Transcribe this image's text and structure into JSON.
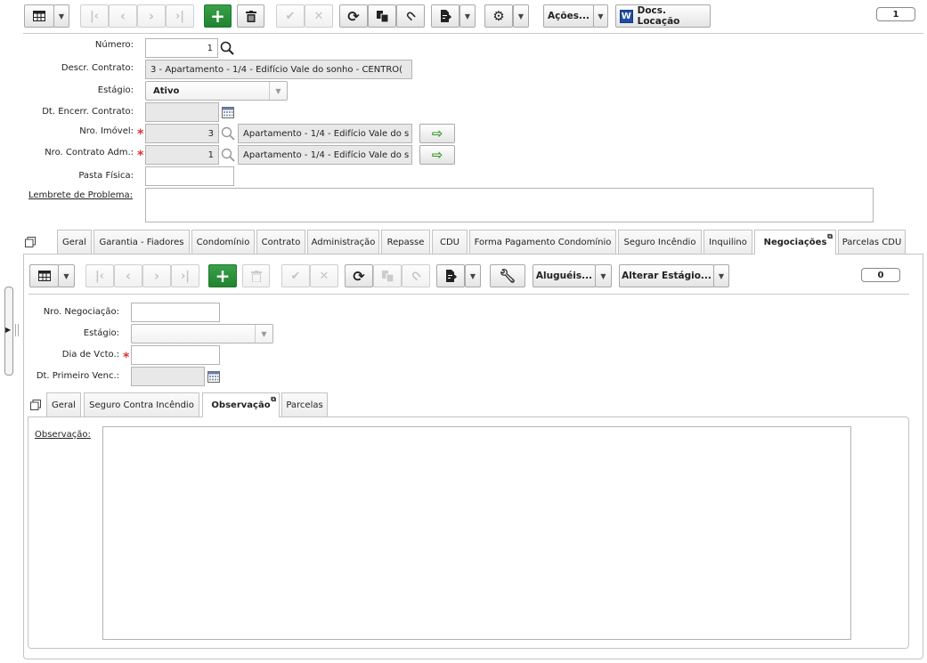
{
  "toolbar": {
    "acoes_label": "Ações...",
    "docs_label": "Docs. Locação",
    "record_count": "1"
  },
  "form": {
    "numero_label": "Número:",
    "numero_value": "1",
    "descr_label": "Descr. Contrato:",
    "descr_value": "3 - Apartamento - 1/4 - Edifício Vale do sonho - CENTRO(",
    "estagio_label": "Estágio:",
    "estagio_value": "Ativo",
    "dt_encerr_label": "Dt. Encerr. Contrato:",
    "dt_encerr_value": "",
    "nro_imovel_label": "Nro. Imóvel:",
    "nro_imovel_value": "3",
    "nro_imovel_desc": "Apartamento - 1/4 - Edifício Vale do s",
    "nro_contrato_label": "Nro. Contrato Adm.:",
    "nro_contrato_value": "1",
    "nro_contrato_desc": "Apartamento - 1/4 - Edifício Vale do s",
    "pasta_label": "Pasta Física:",
    "pasta_value": "",
    "lembrete_label": "Lembrete de Problema:",
    "lembrete_value": ""
  },
  "tabs": [
    {
      "label": "Geral"
    },
    {
      "label": "Garantia - Fiadores"
    },
    {
      "label": "Condomínio"
    },
    {
      "label": "Contrato"
    },
    {
      "label": "Administração"
    },
    {
      "label": "Repasse"
    },
    {
      "label": "CDU"
    },
    {
      "label": "Forma Pagamento Condomínio"
    },
    {
      "label": "Seguro Incêndio"
    },
    {
      "label": "Inquilino"
    },
    {
      "label": "Negociações"
    },
    {
      "label": "Parcelas CDU"
    }
  ],
  "inner_toolbar": {
    "alugueis_label": "Aluguéis...",
    "alterar_label": "Alterar Estágio...",
    "record_count": "0"
  },
  "inner_form": {
    "nro_neg_label": "Nro. Negociação:",
    "nro_neg_value": "",
    "estagio_label": "Estágio:",
    "estagio_value": "",
    "dia_vcto_label": "Dia de Vcto.:",
    "dia_vcto_value": "",
    "dt_primeiro_label": "Dt. Primeiro Venc.:",
    "dt_primeiro_value": ""
  },
  "inner_tabs": [
    {
      "label": "Geral"
    },
    {
      "label": "Seguro Contra Incêndio"
    },
    {
      "label": "Observação"
    },
    {
      "label": "Parcelas"
    }
  ],
  "observacao": {
    "label": "Observação:",
    "value": ""
  },
  "colors": {
    "accent_green": "#2a8f37",
    "required": "#dd3333"
  }
}
